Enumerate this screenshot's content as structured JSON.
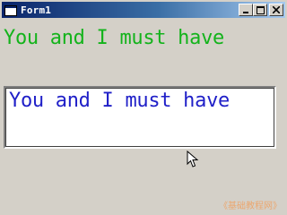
{
  "window": {
    "title": "Form1",
    "icon": "form-window-icon",
    "controls": {
      "minimize_icon": "minimize-icon",
      "maximize_icon": "maximize-icon",
      "close_icon": "close-icon"
    }
  },
  "label": {
    "text": "You and I must have"
  },
  "textbox": {
    "value": "You and I must have"
  },
  "watermark": {
    "text": "《基础教程网》"
  },
  "colors": {
    "label_text": "#13b31b",
    "textbox_text": "#2020c8",
    "titlebar_start": "#0a246a",
    "titlebar_end": "#a6caf0",
    "face": "#d4d0c8"
  }
}
